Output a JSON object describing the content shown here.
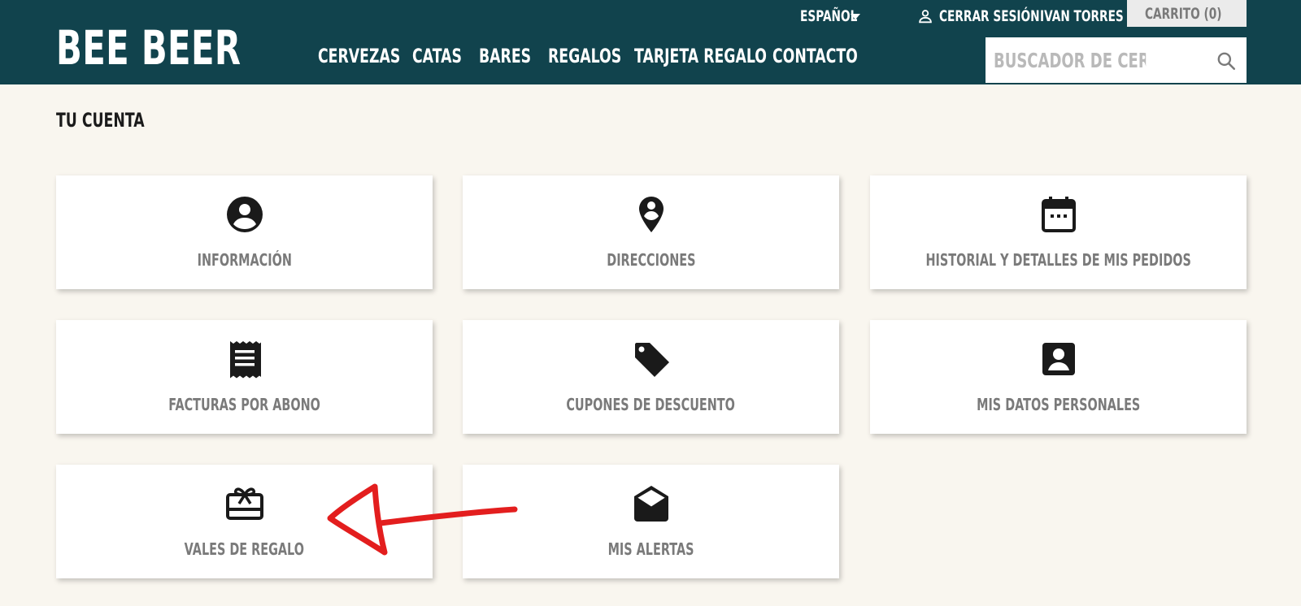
{
  "header": {
    "logo": "BEE BEER",
    "nav": [
      "CERVEZAS",
      "CATAS",
      "BARES",
      "REGALOS",
      "TARJETA REGALO",
      "CONTACTO"
    ],
    "language": "ESPAÑOL",
    "logout": "CERRAR SESIÓN",
    "user_name": "IVAN TORRES",
    "cart": "CARRITO (0)",
    "search_placeholder": "BUSCADOR DE CERVEZA"
  },
  "page_title": "TU CUENTA",
  "cards": [
    {
      "label": "INFORMACIÓN",
      "icon": "account-circle-icon"
    },
    {
      "label": "DIRECCIONES",
      "icon": "location-pin-icon"
    },
    {
      "label": "HISTORIAL Y DETALLES DE MIS PEDIDOS",
      "icon": "calendar-icon"
    },
    {
      "label": "FACTURAS POR ABONO",
      "icon": "receipt-icon"
    },
    {
      "label": "CUPONES DE DESCUENTO",
      "icon": "tag-icon"
    },
    {
      "label": "MIS DATOS PERSONALES",
      "icon": "account-box-icon"
    },
    {
      "label": "VALES DE REGALO",
      "icon": "gift-card-icon"
    },
    {
      "label": "MIS ALERTAS",
      "icon": "mail-open-icon"
    }
  ],
  "colors": {
    "header_bg": "#11434d",
    "page_bg": "#f9f6ef",
    "annotation_arrow": "#e31e1e"
  }
}
